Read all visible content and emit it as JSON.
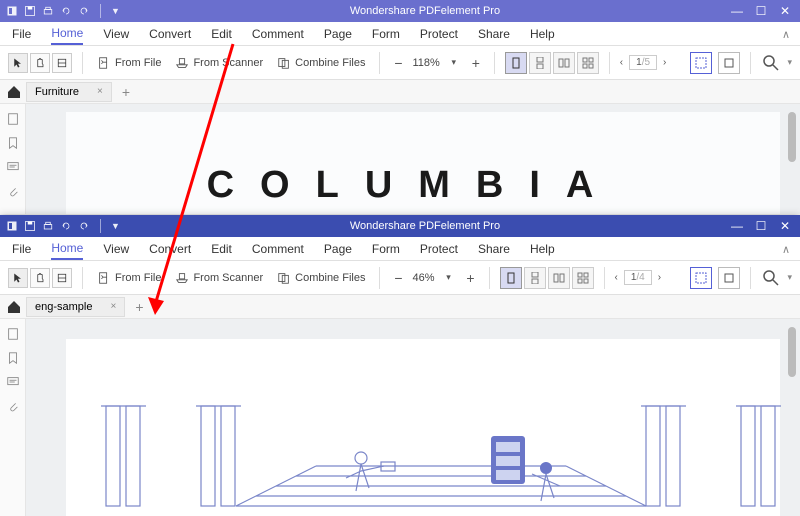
{
  "app_title": "Wondershare PDFelement Pro",
  "menu": {
    "file": "File",
    "home": "Home",
    "view": "View",
    "convert": "Convert",
    "edit": "Edit",
    "comment": "Comment",
    "page": "Page",
    "form": "Form",
    "protect": "Protect",
    "share": "Share",
    "help": "Help"
  },
  "toolbar": {
    "from_file": "From File",
    "from_scanner": "From Scanner",
    "combine": "Combine Files"
  },
  "zoom_down": "▾",
  "windows": [
    {
      "titlebar_color": "#6a6fce",
      "zoom": "118%",
      "page_current": "1",
      "page_total": "/5",
      "tab_name": "Furniture",
      "doc_body_text": "COLUMBIA"
    },
    {
      "titlebar_color": "#3b4db0",
      "zoom": "46%",
      "page_current": "1",
      "page_total": "/4",
      "tab_name": "eng-sample",
      "doc_body_text": ""
    }
  ],
  "glyphs": {
    "minus": "−",
    "plus": "+",
    "prev": "‹",
    "next": "›",
    "close": "×",
    "min": "—",
    "max": "☐",
    "winclose": "✕",
    "chev_up": "∧"
  }
}
